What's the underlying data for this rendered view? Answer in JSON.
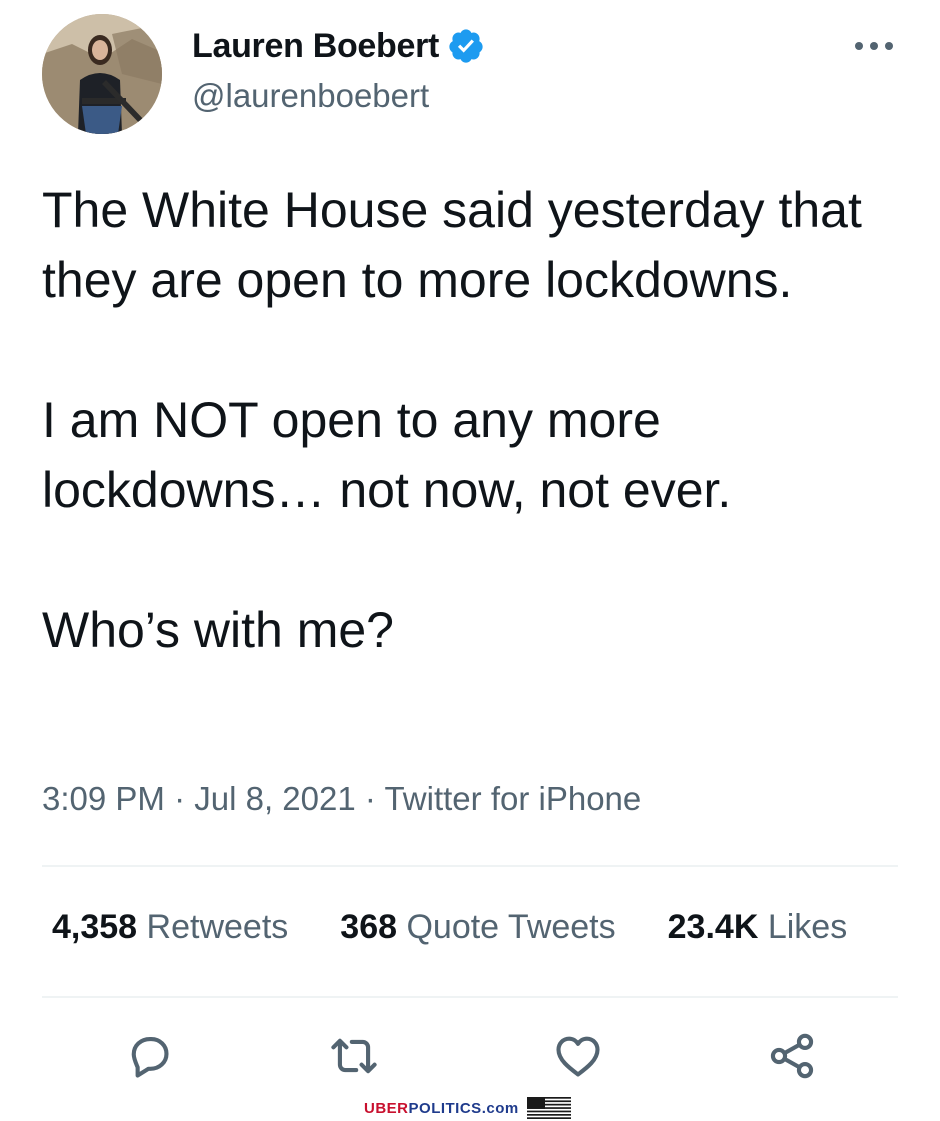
{
  "author": {
    "display_name": "Lauren Boebert",
    "handle": "@laurenboebert",
    "verified": true
  },
  "tweet": {
    "paragraphs": [
      "The White House said yesterday that they are open to more lockdowns.",
      "I am NOT open to any more lockdowns… not now, not ever.",
      "Who’s with me?"
    ],
    "time": "3:09 PM",
    "date": "Jul 8, 2021",
    "source": "Twitter for iPhone",
    "separator": "·"
  },
  "stats": {
    "retweets_count": "4,358",
    "retweets_label": "Retweets",
    "quotes_count": "368",
    "quotes_label": "Quote Tweets",
    "likes_count": "23.4K",
    "likes_label": "Likes"
  },
  "actions": [
    "reply-icon",
    "retweet-icon",
    "like-icon",
    "share-icon"
  ],
  "watermark": {
    "brand_red": "UBER",
    "brand_blue": "POLITICS",
    "suffix": ".com",
    "red": "#c8102e",
    "blue": "#1f3b8c"
  },
  "colors": {
    "text": "#0f1419",
    "secondary": "#536471",
    "verified": "#1d9bf0",
    "divider": "#eff3f4"
  }
}
